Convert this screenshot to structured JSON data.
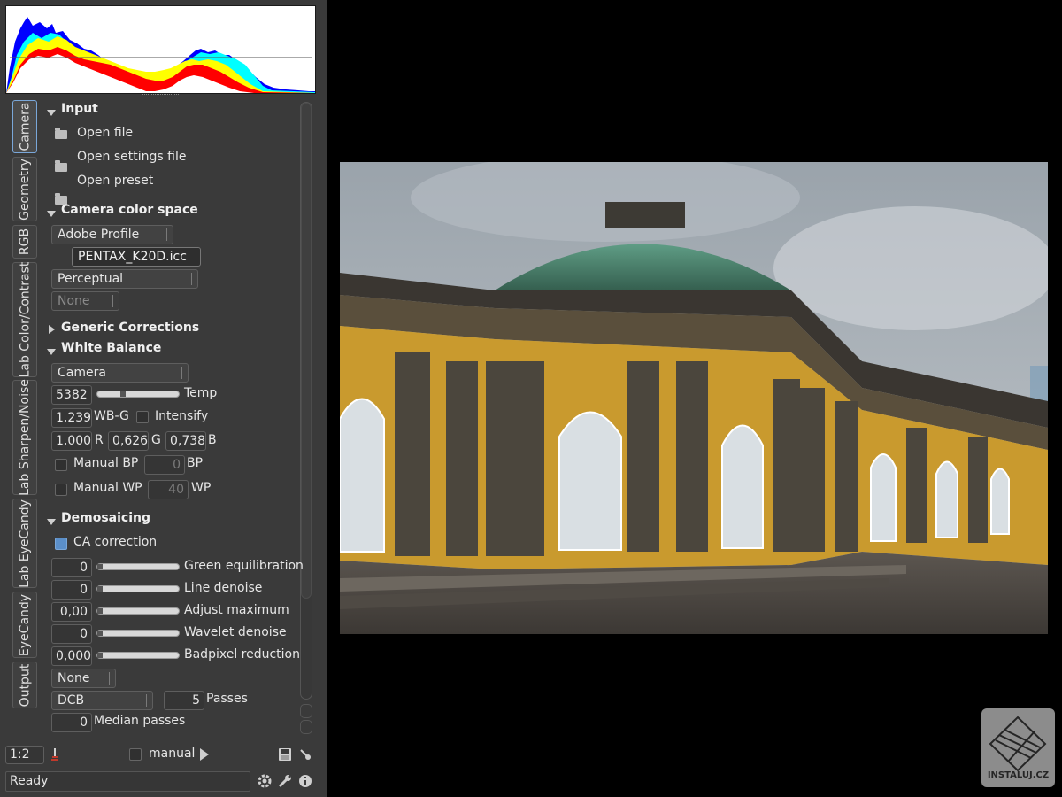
{
  "tabs": [
    "Camera",
    "Geometry",
    "RGB",
    "Lab Color/Contrast",
    "Lab Sharpen/Noise",
    "Lab EyeCandy",
    "EyeCandy",
    "Output"
  ],
  "input": {
    "title": "Input",
    "open_file": "Open file",
    "open_settings": "Open settings file",
    "open_preset": "Open preset"
  },
  "camera_color_space": {
    "title": "Camera color space",
    "profile": "Adobe Profile",
    "icc_file": "PENTAX_K20D.icc",
    "intent": "Perceptual",
    "secondary": "None"
  },
  "generic": {
    "title": "Generic Corrections"
  },
  "white_balance": {
    "title": "White Balance",
    "mode": "Camera",
    "temp_value": "5382",
    "temp_label": "Temp",
    "temp_level": 0.3,
    "wbg_value": "1,239",
    "wbg_label": "WB-G",
    "intensify_label": "Intensify",
    "r_value": "1,000",
    "r_label": "R",
    "g_value": "0,626",
    "g_label": "G",
    "b_value": "0,738",
    "b_label": "B",
    "manual_bp_label": "Manual BP",
    "bp_value": "0",
    "bp_label": "BP",
    "manual_wp_label": "Manual WP",
    "wp_value": "40",
    "wp_label": "WP"
  },
  "demosaicing": {
    "title": "Demosaicing",
    "ca_label": "CA correction",
    "rows": [
      {
        "value": "0",
        "label": "Green equilibration"
      },
      {
        "value": "0",
        "label": "Line denoise"
      },
      {
        "value": "0,00",
        "label": "Adjust maximum"
      },
      {
        "value": "0",
        "label": "Wavelet denoise"
      },
      {
        "value": "0,000",
        "label": "Badpixel reduction"
      }
    ],
    "none_combo": "None",
    "algo": "DCB",
    "passes_value": "5",
    "passes_label": "Passes",
    "median_value": "0",
    "median_label": "Median passes"
  },
  "bottom": {
    "zoom": "1:2",
    "manual_label": "manual",
    "status": "Ready"
  },
  "watermark": "INSTALUJ.CZ",
  "colors": {
    "panel": "#3a3a3a",
    "accent": "#5b8fc9",
    "facade": "#c99a2e",
    "dome": "#4b8a72",
    "sky": "#aeb6bd"
  }
}
